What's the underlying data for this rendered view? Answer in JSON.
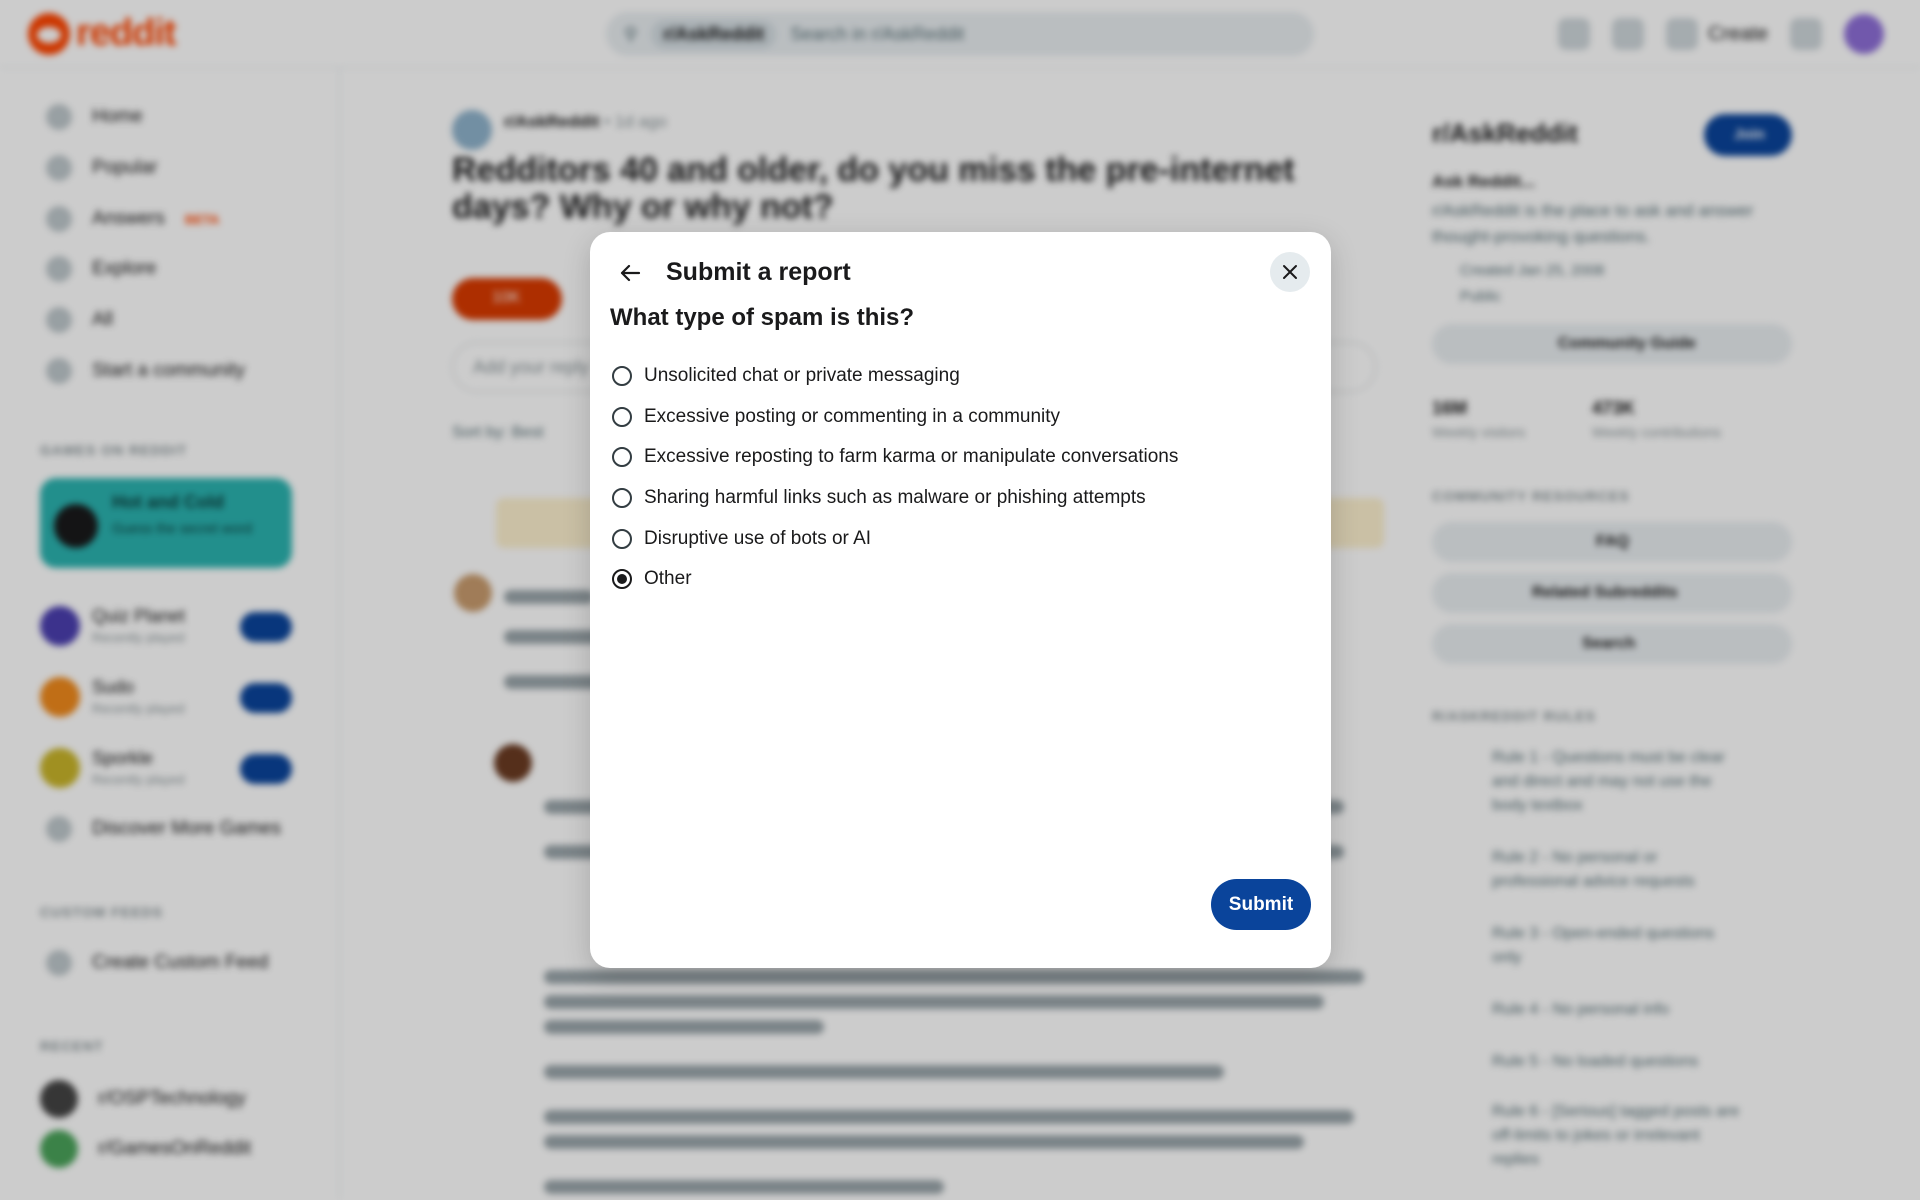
{
  "header": {
    "logo_text": "reddit",
    "search_chip": "r/AskReddit",
    "search_placeholder": "Search in r/AskReddit",
    "create_label": "Create"
  },
  "sidebar": {
    "items": [
      {
        "label": "Home",
        "icon": "home-icon"
      },
      {
        "label": "Popular",
        "icon": "popular-icon"
      },
      {
        "label": "Answers",
        "icon": "answers-icon",
        "badge": "BETA"
      },
      {
        "label": "Explore",
        "icon": "explore-icon"
      },
      {
        "label": "All",
        "icon": "all-icon"
      },
      {
        "label": "Start a community",
        "icon": "plus-icon"
      }
    ],
    "games_heading": "GAMES ON REDDIT",
    "promo": {
      "title": "Hot and Cold",
      "subtitle": "Guess the secret word"
    },
    "games": [
      {
        "name": "Quiz Planet",
        "sub": "Recently played"
      },
      {
        "name": "Sudo",
        "sub": "Recently played"
      },
      {
        "name": "Sporkle",
        "sub": "Recently played"
      }
    ],
    "discover_label": "Discover More Games",
    "custom_feeds_heading": "CUSTOM FEEDS",
    "create_feed_label": "Create Custom Feed",
    "recent_heading": "RECENT",
    "recent": [
      "r/OSPTechnology",
      "r/GamesOnReddit"
    ]
  },
  "post": {
    "subreddit": "r/AskReddit",
    "age": "• 1d ago",
    "title": "Redditors 40 and older, do you miss the pre-internet days? Why or why not?",
    "vote_count": "10K",
    "comment_placeholder": "Add your reply",
    "sort_label": "Sort by: Best"
  },
  "right_panel": {
    "title": "r/AskReddit",
    "join_label": "Join",
    "about_title": "Ask Reddit...",
    "about_text": "r/AskReddit is the place to ask and answer thought-provoking questions.",
    "created": "Created Jan 25, 2008",
    "visibility": "Public",
    "guide_label": "Community Guide",
    "stats": [
      {
        "value": "16M",
        "label": "Weekly visitors"
      },
      {
        "value": "473K",
        "label": "Weekly contributions"
      }
    ],
    "resources_heading": "COMMUNITY RESOURCES",
    "resources": [
      "FAQ",
      "Related Subreddits",
      "Search"
    ],
    "rules_heading": "R/ASKREDDIT RULES",
    "rules": [
      "Rule 1 - Questions must be clear and direct and may not use the body textbox",
      "Rule 2 - No personal or professional advice requests",
      "Rule 3 - Open-ended questions only",
      "Rule 4 - No personal info",
      "Rule 5 - No loaded questions",
      "Rule 6 - [Serious] tagged posts are off-limits to jokes or irrelevant replies"
    ]
  },
  "modal": {
    "title": "Submit a report",
    "question": "What type of spam is this?",
    "options": [
      "Unsolicited chat or private messaging",
      "Excessive posting or commenting in a community",
      "Excessive reposting to farm karma or manipulate conversations",
      "Sharing harmful links such as malware or phishing attempts",
      "Disruptive use of bots or AI",
      "Other"
    ],
    "selected_option": "Other",
    "submit_label": "Submit",
    "back_icon": "arrow-left-icon",
    "close_icon": "close-icon"
  },
  "colors": {
    "brand": "#ff4500",
    "primary_button": "#0a449b",
    "scrim": "rgba(0,0,0,0.20)"
  }
}
